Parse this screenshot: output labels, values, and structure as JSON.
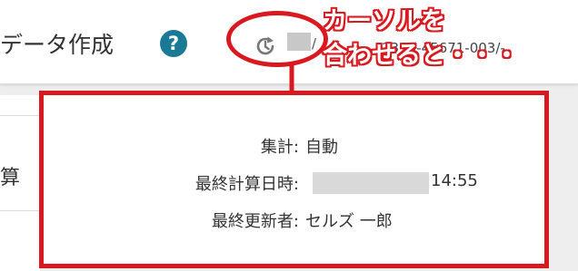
{
  "header": {
    "title": "データ作成",
    "help_icon_glyph": "?",
    "version_fragment": "/",
    "record_id": "2310-45671-003/-"
  },
  "annotation": {
    "callout_line1": "カーソルを",
    "callout_line2": "合わせると・・・",
    "color": "#d8191f"
  },
  "side": {
    "label": "算"
  },
  "tooltip": {
    "rows": [
      {
        "label": "集計:",
        "value": "自動"
      },
      {
        "label": "最終計算日時:",
        "value": "14:55"
      },
      {
        "label": "最終更新者:",
        "value": "セルズ 一郎"
      }
    ]
  },
  "colors": {
    "help_icon": "#1a7a96",
    "accent_red": "#d8191f"
  }
}
